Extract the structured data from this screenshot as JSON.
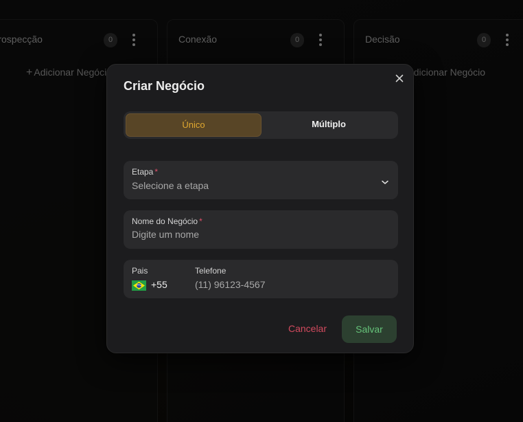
{
  "board": {
    "columns": [
      {
        "title": "Prospecção",
        "count": "0",
        "add_label": "Adicionar Negócio"
      },
      {
        "title": "Conexão",
        "count": "0",
        "add_label": ""
      },
      {
        "title": "Decisão",
        "count": "0",
        "add_label": "Adicionar Negócio"
      }
    ]
  },
  "modal": {
    "title": "Criar Negócio",
    "tabs": [
      {
        "label": "Único",
        "active": true
      },
      {
        "label": "Múltiplo",
        "active": false
      }
    ],
    "stage_field": {
      "label": "Etapa",
      "required_mark": "*",
      "value": "Selecione a etapa"
    },
    "name_field": {
      "label": "Nome do Negócio",
      "required_mark": "*",
      "placeholder": "Digite um nome"
    },
    "phone_field": {
      "country_label": "Pais",
      "country_flag_icon": "brazil-flag-icon",
      "dial_code": "+55",
      "phone_label": "Telefone",
      "phone_placeholder": "(11) 96123-4567"
    },
    "cancel_label": "Cancelar",
    "save_label": "Salvar"
  },
  "colors": {
    "accent": "#e0a830",
    "danger": "#d24a5e",
    "success": "#66c37a"
  }
}
